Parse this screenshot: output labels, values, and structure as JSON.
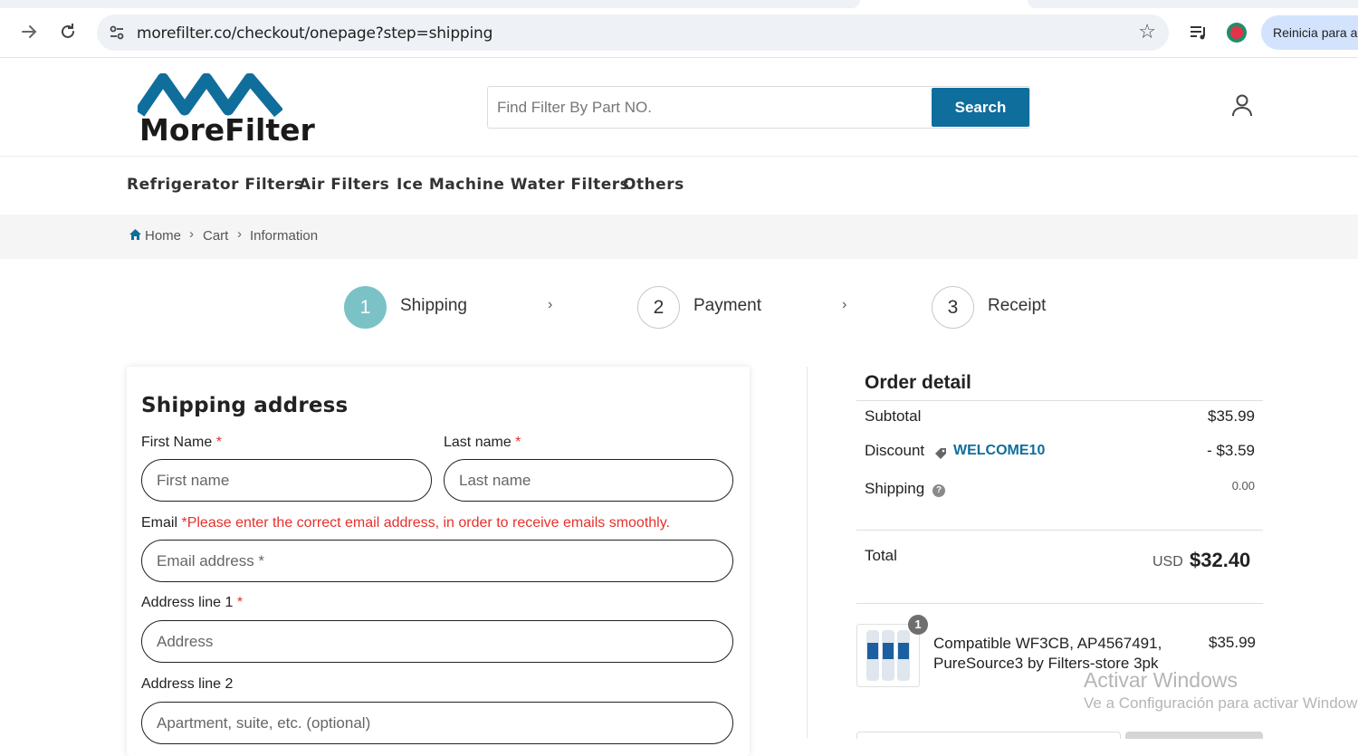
{
  "browser": {
    "url": "morefilter.co/checkout/onepage?step=shipping",
    "profile_label": "Reinicia para actualizar"
  },
  "header": {
    "logo_text": "MoreFilter",
    "search_placeholder": "Find Filter By Part NO.",
    "search_button": "Search",
    "brand_color": "#0f6e9c"
  },
  "nav": {
    "items": [
      "Refrigerator Filters",
      "Air Filters",
      "Ice Machine Water Filters",
      "Others"
    ]
  },
  "breadcrumb": {
    "items": [
      "Home",
      "Cart",
      "Information"
    ]
  },
  "steps": [
    {
      "number": "1",
      "label": "Shipping",
      "active": true
    },
    {
      "number": "2",
      "label": "Payment",
      "active": false
    },
    {
      "number": "3",
      "label": "Receipt",
      "active": false
    }
  ],
  "shipping_form": {
    "title": "Shipping address",
    "first_name_label": "First Name",
    "first_name_placeholder": "First name",
    "last_name_label": "Last name",
    "last_name_placeholder": "Last name",
    "email_label": "Email",
    "email_warning": "*Please enter the correct email address, in order to receive emails smoothly.",
    "email_placeholder": "Email address *",
    "address1_label": "Address line 1",
    "address1_placeholder": "Address",
    "address2_label": "Address line 2",
    "address2_placeholder": "Apartment, suite, etc. (optional)",
    "required_mark": "*"
  },
  "order_detail": {
    "title": "Order detail",
    "subtotal_label": "Subtotal",
    "subtotal_value": "$35.99",
    "discount_label": "Discount",
    "discount_code": "WELCOME10",
    "discount_value": "- $3.59",
    "shipping_label": "Shipping",
    "shipping_value": "0.00",
    "total_label": "Total",
    "total_currency": "USD",
    "total_value": "$32.40",
    "product": {
      "quantity": "1",
      "name": "Compatible WF3CB, AP4567491, PureSource3 by Filters-store 3pk",
      "price": "$35.99"
    }
  },
  "watermark": {
    "line1": "Activar Windows",
    "line2": "Ve a Configuración para activar Windows."
  }
}
